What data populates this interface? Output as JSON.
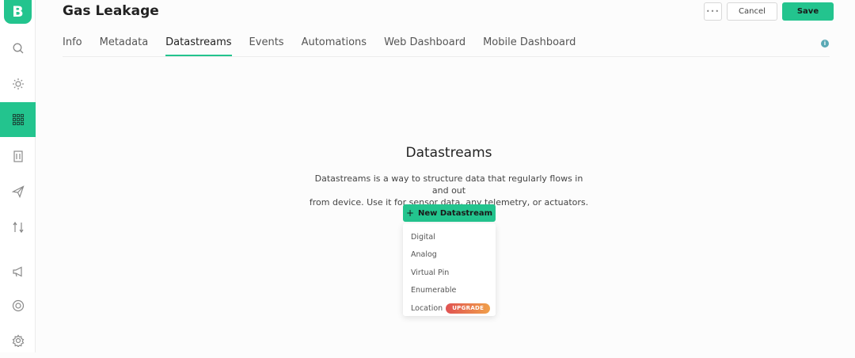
{
  "app": {
    "logo_letter": "B",
    "brand_color": "#23c48e"
  },
  "header": {
    "title": "Gas Leakage",
    "more_label": "•••",
    "cancel_label": "Cancel",
    "save_label": "Save"
  },
  "tabs": [
    {
      "label": "Info",
      "active": false
    },
    {
      "label": "Metadata",
      "active": false
    },
    {
      "label": "Datastreams",
      "active": true
    },
    {
      "label": "Events",
      "active": false
    },
    {
      "label": "Automations",
      "active": false
    },
    {
      "label": "Web Dashboard",
      "active": false
    },
    {
      "label": "Mobile Dashboard",
      "active": false
    }
  ],
  "sidebar": {
    "items": [
      {
        "icon": "search-icon"
      },
      {
        "icon": "sun-icon"
      },
      {
        "icon": "grid-icon",
        "active": true
      },
      {
        "icon": "building-icon"
      },
      {
        "icon": "send-icon"
      },
      {
        "icon": "arrows-updown-icon"
      },
      {
        "icon": "megaphone-icon"
      },
      {
        "icon": "lifebuoy-icon"
      },
      {
        "icon": "gear-icon"
      }
    ]
  },
  "empty_state": {
    "title": "Datastreams",
    "description_line1": "Datastreams is a way to structure data that regularly flows in and out",
    "description_line2": "from device. Use it for sensor data, any telemetry, or actuators.",
    "new_button_label": "New Datastream",
    "new_button_icon": "plus-icon"
  },
  "dropdown": {
    "items": [
      {
        "label": "Digital"
      },
      {
        "label": "Analog"
      },
      {
        "label": "Virtual Pin"
      },
      {
        "label": "Enumerable"
      },
      {
        "label": "Location",
        "badge": "UPGRADE"
      }
    ]
  },
  "info_icon_label": "i"
}
